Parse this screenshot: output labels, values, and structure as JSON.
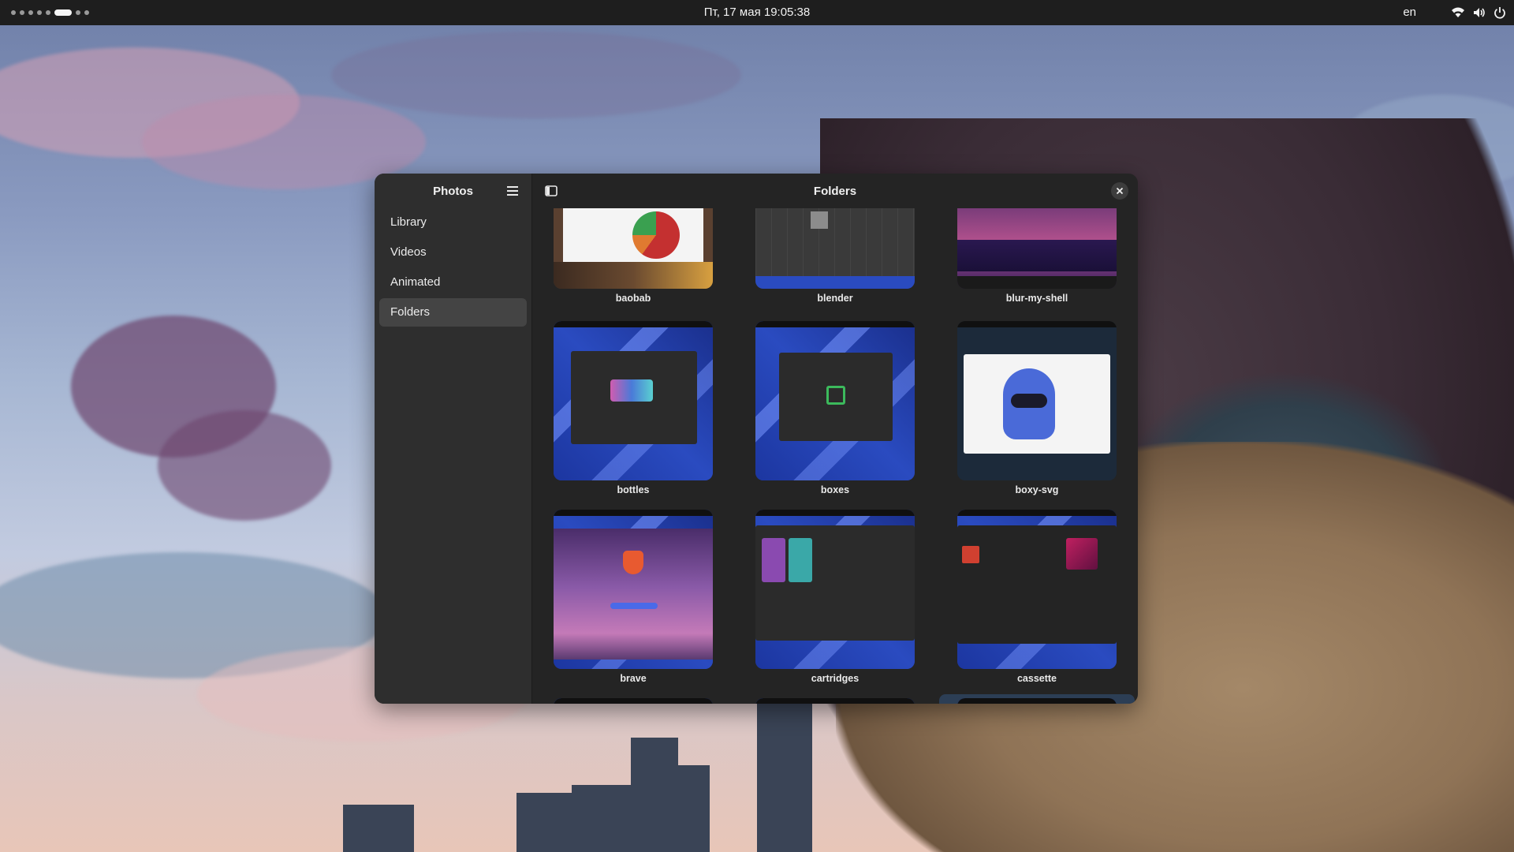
{
  "topbar": {
    "clock": "Пт, 17 мая  19:05:38",
    "language": "en",
    "icons": [
      "wifi-icon",
      "volume-icon",
      "power-icon"
    ]
  },
  "sidebar": {
    "title": "Photos",
    "items": [
      {
        "label": "Library",
        "active": false
      },
      {
        "label": "Videos",
        "active": false
      },
      {
        "label": "Animated",
        "active": false
      },
      {
        "label": "Folders",
        "active": true
      }
    ]
  },
  "content": {
    "title": "Folders",
    "folders": [
      {
        "label": "baobab"
      },
      {
        "label": "blender"
      },
      {
        "label": "blur-my-shell"
      },
      {
        "label": "bottles"
      },
      {
        "label": "boxes"
      },
      {
        "label": "boxy-svg"
      },
      {
        "label": "brave"
      },
      {
        "label": "cartridges"
      },
      {
        "label": "cassette"
      }
    ]
  },
  "colors": {
    "topbar": "#1e1e1e",
    "window": "#242424",
    "sidebar": "#2e2e2e",
    "active_item": "#444444"
  }
}
